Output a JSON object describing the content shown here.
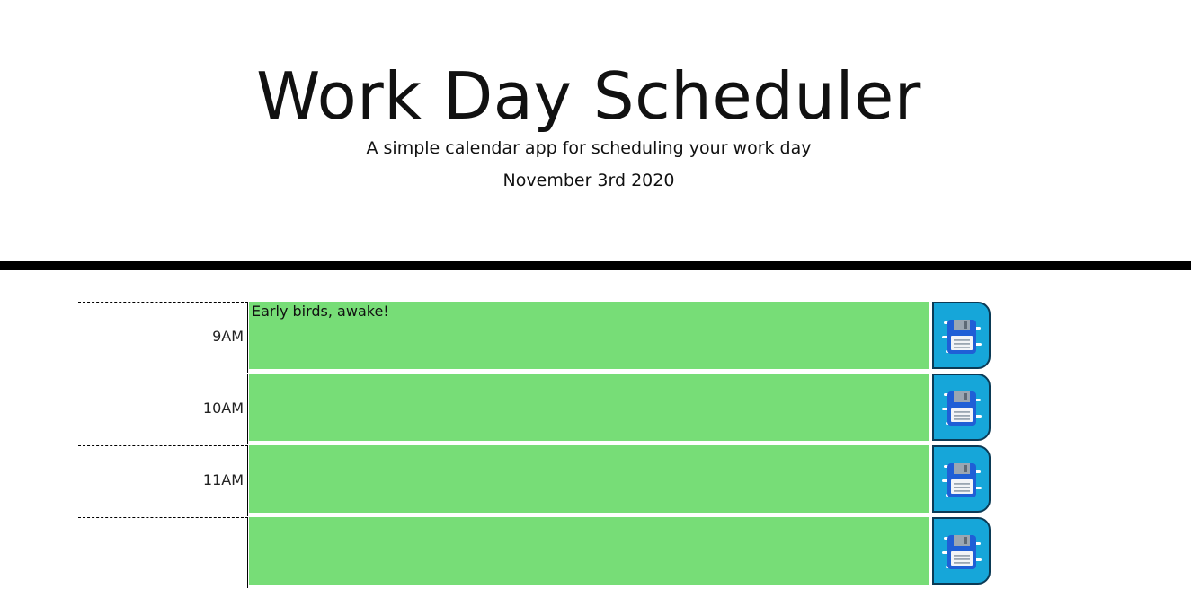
{
  "header": {
    "title": "Work Day Scheduler",
    "subtitle": "A simple calendar app for scheduling your work day",
    "date": "November 3rd 2020"
  },
  "colors": {
    "present_or_future": "#77dd77",
    "save_button": "#16a6d9",
    "divider": "#000000"
  },
  "time_blocks": [
    {
      "hour": "9AM",
      "event": "Early birds, awake!",
      "save_icon": "save-icon"
    },
    {
      "hour": "10AM",
      "event": "",
      "save_icon": "save-icon"
    },
    {
      "hour": "11AM",
      "event": "",
      "save_icon": "save-icon"
    },
    {
      "hour": "",
      "event": "",
      "save_icon": "save-icon"
    }
  ]
}
